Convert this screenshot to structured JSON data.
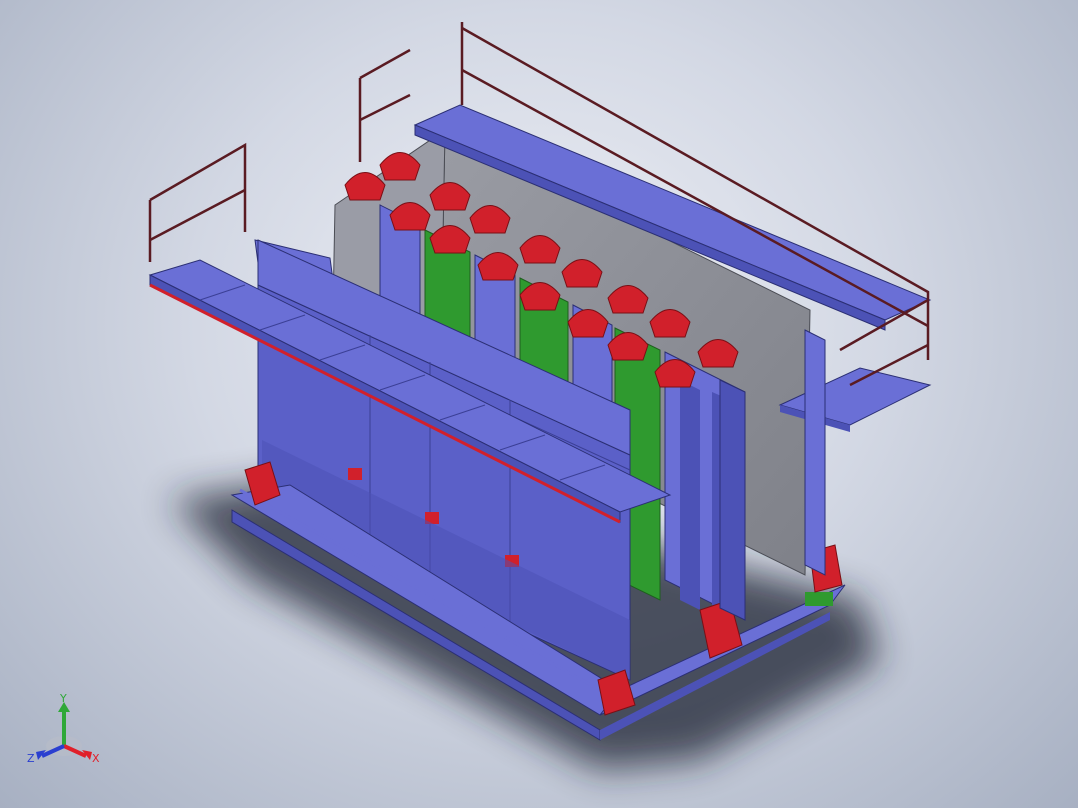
{
  "viewport": {
    "background_top": "#eef0f6",
    "background_bottom": "#a7b0c2"
  },
  "model": {
    "colors": {
      "frame": "#6a6fd6",
      "frame_dark": "#4c52b6",
      "frame_edge": "#2b2f74",
      "red_parts": "#d1202b",
      "green_panels": "#2f9a2f",
      "gray_plate": "#8d8f96",
      "railing": "#5a1b22",
      "shadow": "#1e2230"
    },
    "icons": [
      "assembly-model",
      "triad-icon"
    ]
  },
  "triad": {
    "x_label": "X",
    "y_label": "Y",
    "z_label": "Z",
    "x_color": "#e0202a",
    "y_color": "#2fa838",
    "z_color": "#2a3fd0"
  }
}
